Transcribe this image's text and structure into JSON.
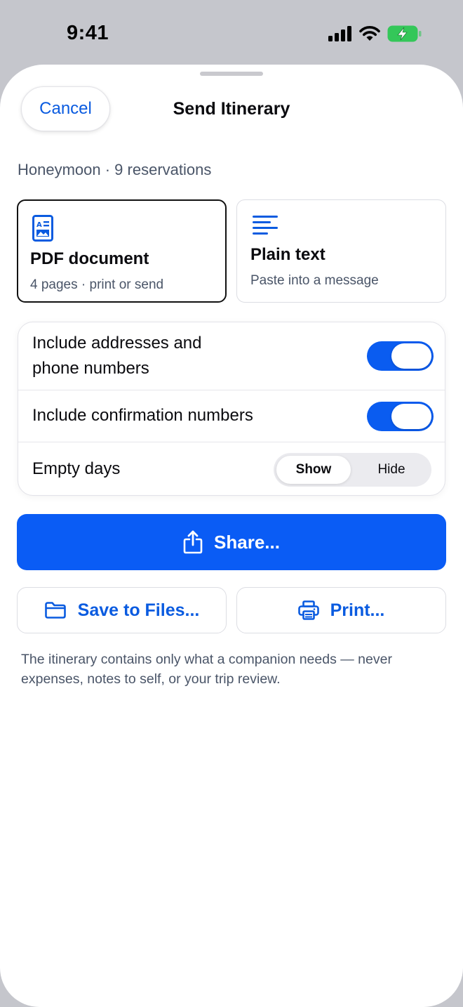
{
  "status_bar": {
    "time": "9:41"
  },
  "sheet": {
    "cancel_label": "Cancel",
    "title": "Send Itinerary",
    "subtitle": "Honeymoon · 9 reservations"
  },
  "formats": [
    {
      "title": "PDF document",
      "description": "4 pages · print or send",
      "icon": "pdf-document-icon",
      "selected": true
    },
    {
      "title": "Plain text",
      "description": "Paste into a message",
      "icon": "text-lines-icon",
      "selected": false
    }
  ],
  "options": {
    "addresses": {
      "label_line1": "Include addresses and",
      "label_line2": "phone numbers",
      "on": true
    },
    "confirmation": {
      "label": "Include confirmation numbers",
      "on": true
    },
    "empty_days": {
      "label": "Empty days",
      "choices": [
        "Show",
        "Hide"
      ],
      "selected": "Show"
    }
  },
  "actions": {
    "share_label": "Share...",
    "save_label": "Save to Files...",
    "print_label": "Print..."
  },
  "footnote": "The itinerary contains only what a companion needs — never expenses, notes to self, or your trip review.",
  "colors": {
    "accent": "#0a5cf5",
    "battery": "#34c759",
    "text_secondary": "#4a5568"
  }
}
